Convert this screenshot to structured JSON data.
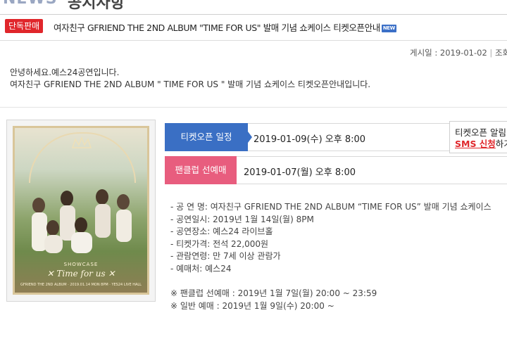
{
  "header": {
    "title_cut": "NEWS",
    "title_cut2": "공지사항"
  },
  "post": {
    "badge": "단독판매",
    "title": "여자친구 GFRIEND THE 2ND ALBUM \"TIME FOR US\" 발매 기념 쇼케이스 티켓오픈안내",
    "new_badge": "NEW",
    "meta_label": "게시일 : 2019-01-02",
    "meta_sep": "|",
    "meta_more": "조회"
  },
  "intro": {
    "line1": "안녕하세요.예스24공연입니다.",
    "line2": "여자친구 GFRIEND THE 2ND ALBUM \" TIME FOR US \" 발매 기념 쇼케이스 티켓오픈안내입니다."
  },
  "poster": {
    "title_small": "SHOWCASE",
    "title_main": "✕ Time for us ✕",
    "subtitle": "GFRIEND THE 2ND ALBUM · 2019.01.14 MON 8PM · YES24 LIVE HALL"
  },
  "schedule": {
    "ticket_open_label": "티켓오픈 일정",
    "ticket_open_value": "2019-01-09(수) 오후 8:00",
    "fanclub_label": "팬클럽 선예매",
    "fanclub_value": "2019-01-07(월) 오후 8:00",
    "sms_line1": "티켓오픈 알림",
    "sms_link": "SMS 신청",
    "sms_line2_suffix": "하기"
  },
  "details": [
    "- 공 연 명: 여자친구 GFRIEND THE 2ND ALBUM “TIME FOR US” 발매 기념 쇼케이스",
    "- 공연일시: 2019년 1월 14일(월) 8PM",
    "- 공연장소: 예스24 라이브홀",
    "- 티켓가격: 전석 22,000원",
    "- 관람연령: 만 7세 이상 관람가",
    "- 예매처: 예스24"
  ],
  "notes": [
    "※ 팬클럽 선예매 : 2019년 1월 7일(월) 20:00 ~ 23:59",
    "※ 일반 예매 : 2019년 1월 9일(수) 20:00 ~"
  ],
  "colors": {
    "blue": "#3a6fc4",
    "pink": "#e85d7e",
    "red": "#e0262b"
  }
}
